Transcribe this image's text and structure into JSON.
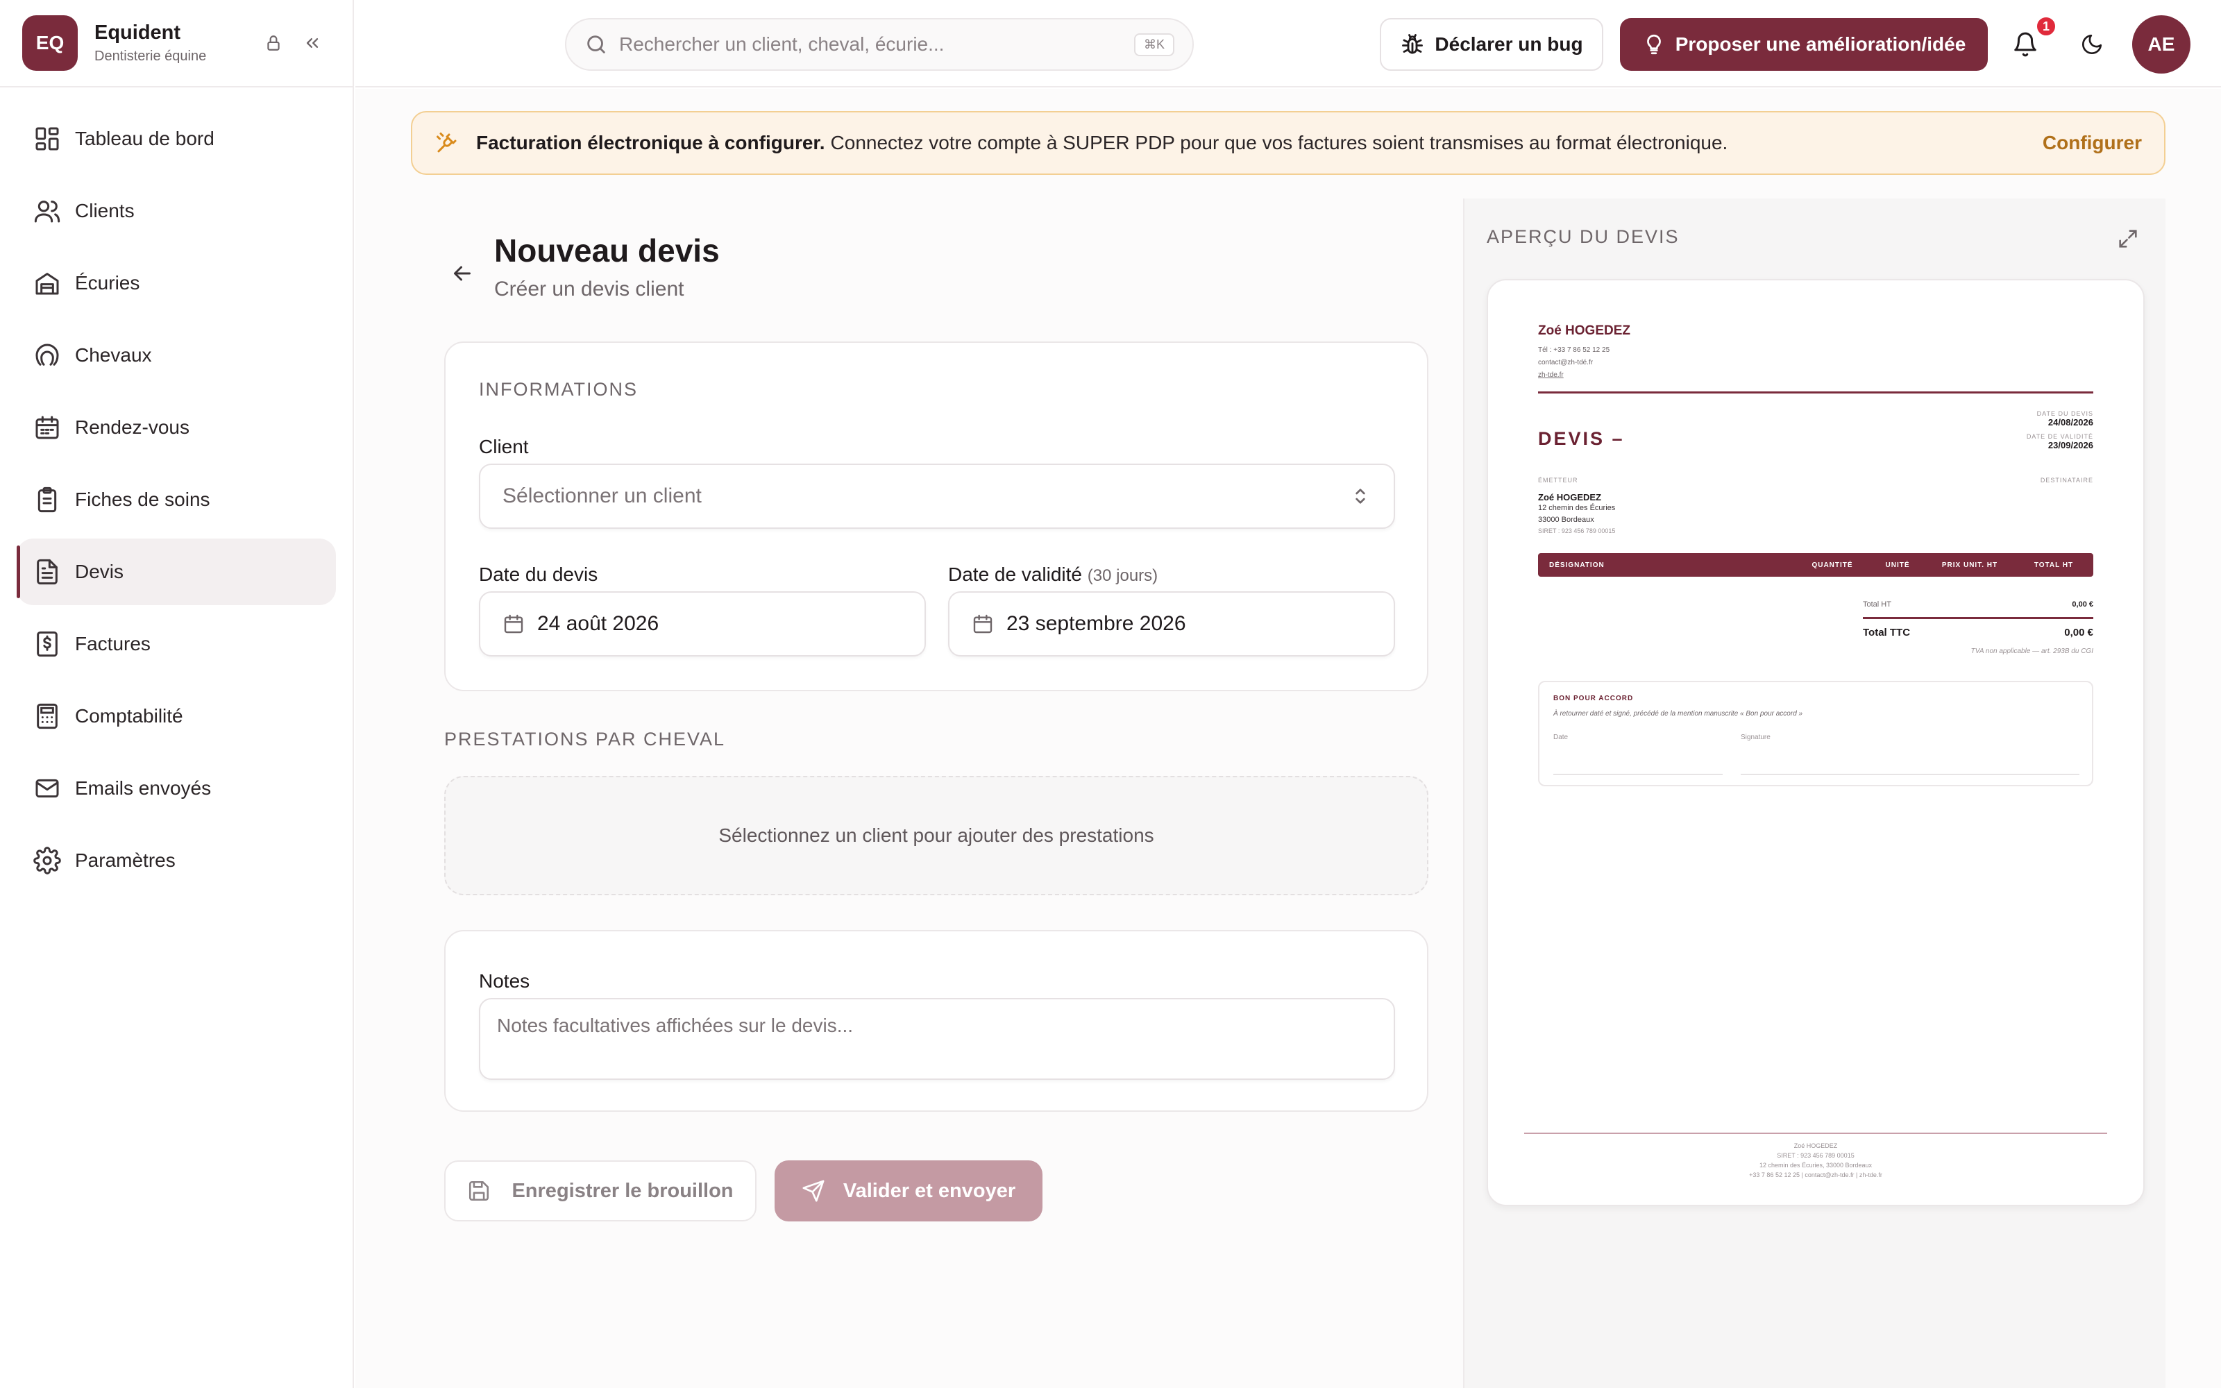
{
  "brand": {
    "logo": "EQ",
    "name": "Equident",
    "subtitle": "Dentisterie équine"
  },
  "sidebar": {
    "items": [
      {
        "label": "Tableau de bord",
        "icon": "dashboard-icon"
      },
      {
        "label": "Clients",
        "icon": "users-icon"
      },
      {
        "label": "Écuries",
        "icon": "stable-icon"
      },
      {
        "label": "Chevaux",
        "icon": "horseshoe-icon"
      },
      {
        "label": "Rendez-vous",
        "icon": "calendar-icon"
      },
      {
        "label": "Fiches de soins",
        "icon": "clipboard-icon"
      },
      {
        "label": "Devis",
        "icon": "document-icon",
        "active": true
      },
      {
        "label": "Factures",
        "icon": "invoice-icon"
      },
      {
        "label": "Comptabilité",
        "icon": "calculator-icon"
      },
      {
        "label": "Emails envoyés",
        "icon": "mail-icon"
      },
      {
        "label": "Paramètres",
        "icon": "gear-icon"
      }
    ]
  },
  "topbar": {
    "search_placeholder": "Rechercher un client, cheval, écurie...",
    "search_shortcut": "⌘K",
    "bug_label": "Déclarer un bug",
    "idea_label": "Proposer une amélioration/idée",
    "notification_count": "1",
    "avatar_initials": "AE"
  },
  "banner": {
    "title": "Facturation électronique à configurer.",
    "text": "Connectez votre compte à SUPER PDP pour que vos factures soient transmises au format électronique.",
    "action": "Configurer"
  },
  "page": {
    "title": "Nouveau devis",
    "subtitle": "Créer un devis client"
  },
  "form": {
    "section_info": "INFORMATIONS",
    "client_label": "Client",
    "client_placeholder": "Sélectionner un client",
    "date_label": "Date du devis",
    "date_value": "24 août 2026",
    "validity_label": "Date de validité",
    "validity_hint": "(30 jours)",
    "validity_value": "23 septembre 2026",
    "section_prestations": "PRESTATIONS PAR CHEVAL",
    "prestations_empty": "Sélectionnez un client pour ajouter des prestations",
    "notes_label": "Notes",
    "notes_placeholder": "Notes facultatives affichées sur le devis...",
    "draft_label": "Enregistrer le brouillon",
    "send_label": "Valider et envoyer"
  },
  "preview": {
    "title": "APERÇU DU DEVIS",
    "company_name": "Zoé HOGEDEZ",
    "phone": "Tél : +33 7 86 52 12 25",
    "email": "contact@zh-tdé.fr",
    "website": "zh-tde.fr",
    "doc_title": "DEVIS –",
    "date_label": "DATE DU DEVIS",
    "date_value": "24/08/2026",
    "validity_label": "DATE DE VALIDITÉ",
    "validity_value": "23/09/2026",
    "issuer_label": "ÉMETTEUR",
    "recipient_label": "DESTINATAIRE",
    "issuer_name": "Zoé HOGEDEZ",
    "issuer_address1": "12 chemin des Écuries",
    "issuer_address2": "33000 Bordeaux",
    "issuer_siret": "SIRET : 923 456 789 00015",
    "col_designation": "DÉSIGNATION",
    "col_quantity": "QUANTITÉ",
    "col_unit": "UNITÉ",
    "col_price": "PRIX UNIT. HT",
    "col_total": "TOTAL HT",
    "total_ht_label": "Total HT",
    "total_ht_value": "0,00 €",
    "total_ttc_label": "Total TTC",
    "total_ttc_value": "0,00 €",
    "tva_note": "TVA non applicable — art. 293B du CGI",
    "accord_title": "BON POUR ACCORD",
    "accord_desc": "À retourner daté et signé, précédé de la mention manuscrite « Bon pour accord »",
    "accord_date": "Date",
    "accord_signature": "Signature",
    "footer_line1": "Zoé HOGEDEZ",
    "footer_line2": "SIRET : 923 456 789 00015",
    "footer_line3": "12 chemin des Écuries, 33000 Bordeaux",
    "footer_line4": "+33 7 86 52 12 25 | contact@zh-tde.fr | zh-tde.fr"
  },
  "colors": {
    "brand": "#7a2b3c",
    "banner_bg": "#fdf3e7",
    "banner_border": "#f3cf93",
    "badge": "#e02a3b"
  }
}
